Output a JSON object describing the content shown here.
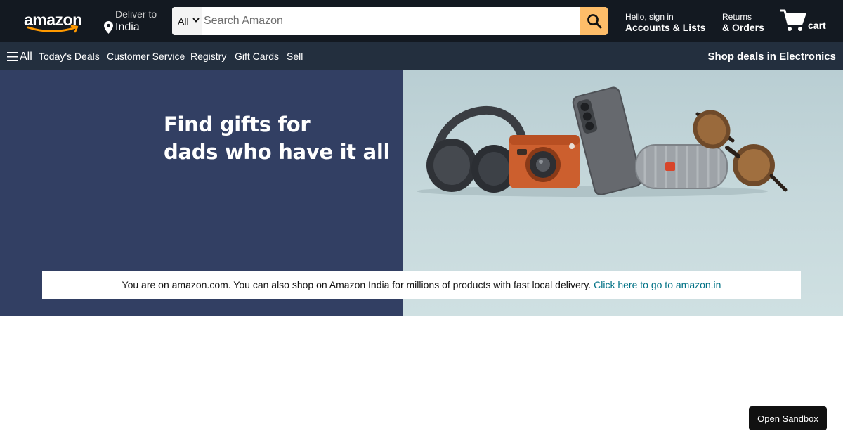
{
  "colors": {
    "header_bg": "#131921",
    "subnav_bg": "#232f3e",
    "search_button": "#febd69",
    "hero_left_bg": "#323f63",
    "hero_right_bg": "#c7d9dc",
    "link": "#007185",
    "smile": "#ff9900"
  },
  "header": {
    "logo_text": "amazon",
    "deliver": {
      "label": "Deliver to",
      "country": "India",
      "icon": "location-pin-icon"
    },
    "search": {
      "category": "All",
      "placeholder": "Search Amazon",
      "value": "",
      "button_icon": "search-icon"
    },
    "account": {
      "greeting": "Hello, sign in",
      "label": "Accounts & Lists"
    },
    "returns": {
      "top": "Returns",
      "bottom": "& Orders"
    },
    "cart": {
      "label": "cart",
      "icon": "cart-icon"
    }
  },
  "subnav": {
    "all_label": "All",
    "all_icon": "hamburger-menu-icon",
    "links": [
      "Today's Deals",
      "Customer Service",
      "Registry",
      "Gift Cards",
      "Sell"
    ],
    "promo": "Shop deals in Electronics"
  },
  "hero": {
    "headline_line1": "Find gifts for",
    "headline_line2": "dads who have it all",
    "products": [
      "headphones",
      "instant-camera",
      "smartphone",
      "bluetooth-speaker",
      "sunglasses"
    ]
  },
  "notice": {
    "text": "You are on amazon.com. You can also shop on Amazon India for millions of products with fast local delivery.",
    "link_text": "Click here to go to amazon.in"
  },
  "sandbox_button": "Open Sandbox"
}
